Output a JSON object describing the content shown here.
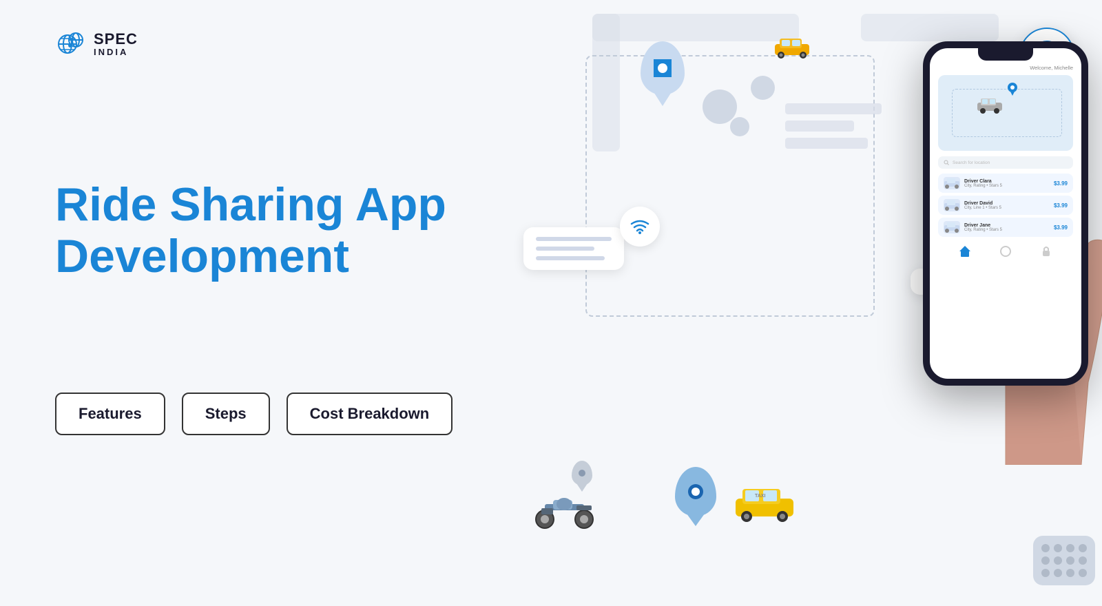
{
  "logo": {
    "company": "SPEC",
    "country": "INDIA",
    "alt": "SPEC INDIA Logo"
  },
  "hero": {
    "title_line1": "Ride Sharing App",
    "title_line2": "Development"
  },
  "buttons": [
    {
      "label": "Features",
      "id": "features-btn"
    },
    {
      "label": "Steps",
      "id": "steps-btn"
    },
    {
      "label": "Cost Breakdown",
      "id": "cost-breakdown-btn"
    }
  ],
  "phone": {
    "welcome": "Welcome, Michelle",
    "search_placeholder": "Search for location",
    "drivers": [
      {
        "name": "Driver Clara",
        "detail": "City, Rating • Stars 5",
        "price": "$3.99"
      },
      {
        "name": "Driver David",
        "detail": "City, Line 1 • Stars 5",
        "price": "$3.99"
      },
      {
        "name": "Driver Jane",
        "detail": "City, Rating • Stars 5",
        "price": "$3.99"
      }
    ]
  },
  "colors": {
    "brand_blue": "#1a85d6",
    "dark": "#1a1a2e",
    "light_bg": "#f5f7fa",
    "gray": "#d8dde8",
    "white": "#ffffff"
  }
}
